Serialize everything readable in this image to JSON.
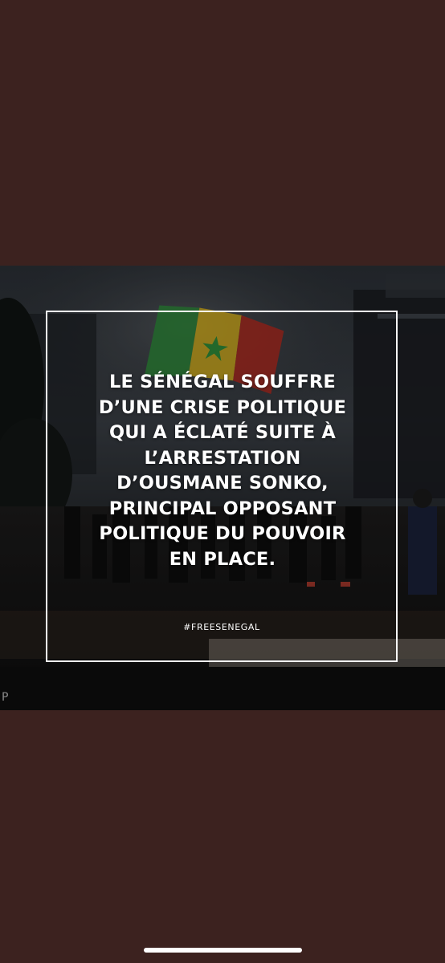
{
  "post": {
    "headline": "LE SÉNÉGAL SOUFFRE\nD’UNE CRISE POLITIQUE\nQUI A ÉCLATÉ SUITE À\nL’ARRESTATION\nD’OUSMANE SONKO,\nPRINCIPAL OPPOSANT\nPOLITIQUE DU POUVOIR\nEN PLACE.",
    "hashtag": "#FREESENEGAL",
    "corner_mark": "P"
  },
  "colors": {
    "page_background": "#3c221f",
    "frame": "#ffffff",
    "text": "#ffffff",
    "flag_green": "#2e8b3a",
    "flag_yellow": "#d8b21c",
    "flag_red": "#b22a1f"
  }
}
